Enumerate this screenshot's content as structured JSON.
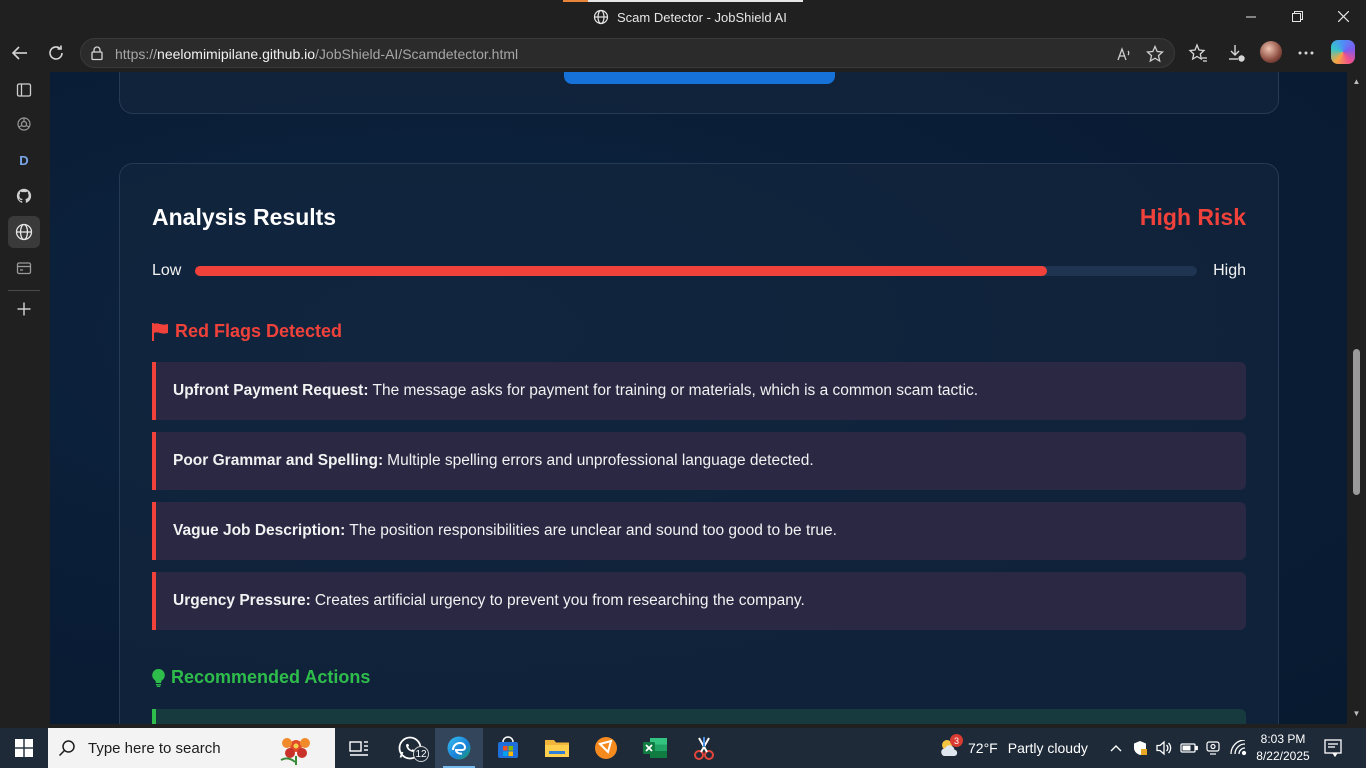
{
  "window": {
    "title": "Scam Detector - JobShield AI"
  },
  "address_bar": {
    "url_prefix": "https://",
    "url_host": "neelomimipilane.github.io",
    "url_path": "/JobShield-AI/Scamdetector.html"
  },
  "sidebar": {
    "items": [
      {
        "icon": "panel-icon"
      },
      {
        "icon": "openai-icon"
      },
      {
        "icon": "d-app-icon",
        "label": "D"
      },
      {
        "icon": "github-icon"
      },
      {
        "icon": "globe-icon",
        "active": true
      },
      {
        "icon": "wallet-icon"
      },
      {
        "icon": "add-icon"
      }
    ]
  },
  "results": {
    "title": "Analysis Results",
    "risk_label": "High Risk",
    "meter_low": "Low",
    "meter_high": "High",
    "risk_level": 0.85,
    "red_flags_heading": "Red Flags Detected",
    "red_flags": [
      {
        "title": "Upfront Payment Request:",
        "text": "The message asks for payment for training or materials, which is a common scam tactic."
      },
      {
        "title": "Poor Grammar and Spelling:",
        "text": "Multiple spelling errors and unprofessional language detected."
      },
      {
        "title": "Vague Job Description:",
        "text": "The position responsibilities are unclear and sound too good to be true."
      },
      {
        "title": "Urgency Pressure:",
        "text": "Creates artificial urgency to prevent you from researching the company."
      }
    ],
    "actions_heading": "Recommended Actions"
  },
  "colors": {
    "danger": "#f0413a",
    "success": "#2ebd4b",
    "primary_button": "#1672d9",
    "page_bg": "#0a1d36"
  },
  "taskbar": {
    "search_placeholder": "Type here to search",
    "whatsapp_badge": "12",
    "weather_badge": "3",
    "temperature": "72°F",
    "weather_desc": "Partly cloudy",
    "time": "8:03 PM",
    "date": "8/22/2025"
  }
}
